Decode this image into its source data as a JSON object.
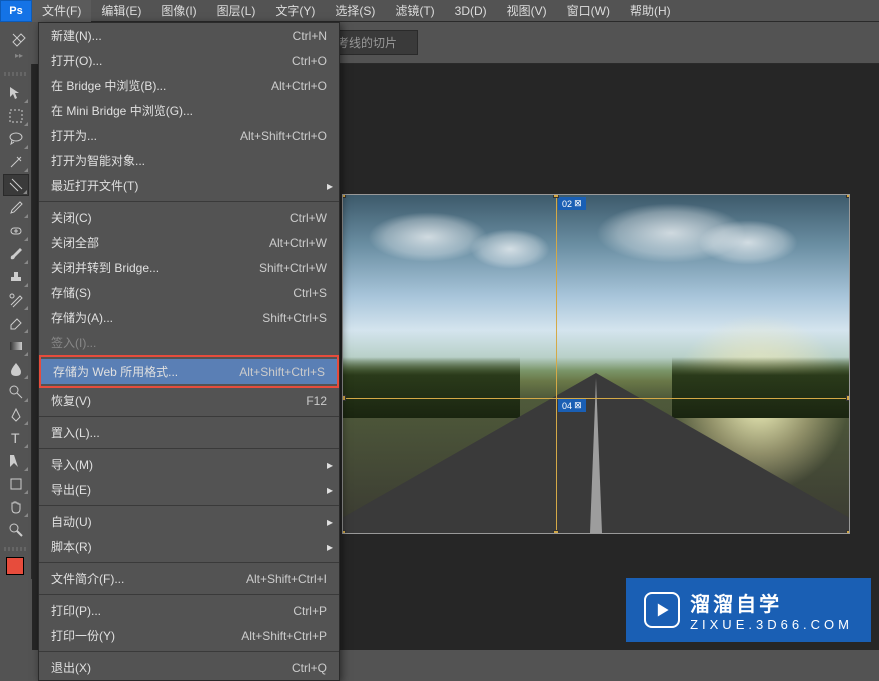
{
  "app": {
    "logo": "Ps"
  },
  "menubar": [
    {
      "label": "文件(F)",
      "active": true
    },
    {
      "label": "编辑(E)"
    },
    {
      "label": "图像(I)"
    },
    {
      "label": "图层(L)"
    },
    {
      "label": "文字(Y)"
    },
    {
      "label": "选择(S)"
    },
    {
      "label": "滤镜(T)"
    },
    {
      "label": "3D(D)"
    },
    {
      "label": "视图(V)"
    },
    {
      "label": "窗口(W)"
    },
    {
      "label": "帮助(H)"
    }
  ],
  "options_bar": {
    "ref_slice": "基于参考线的切片"
  },
  "file_menu": {
    "groups": [
      [
        {
          "label": "新建(N)...",
          "shortcut": "Ctrl+N"
        },
        {
          "label": "打开(O)...",
          "shortcut": "Ctrl+O"
        },
        {
          "label": "在 Bridge 中浏览(B)...",
          "shortcut": "Alt+Ctrl+O"
        },
        {
          "label": "在 Mini Bridge 中浏览(G)..."
        },
        {
          "label": "打开为...",
          "shortcut": "Alt+Shift+Ctrl+O"
        },
        {
          "label": "打开为智能对象..."
        },
        {
          "label": "最近打开文件(T)",
          "submenu": true
        }
      ],
      [
        {
          "label": "关闭(C)",
          "shortcut": "Ctrl+W"
        },
        {
          "label": "关闭全部",
          "shortcut": "Alt+Ctrl+W"
        },
        {
          "label": "关闭并转到 Bridge...",
          "shortcut": "Shift+Ctrl+W"
        },
        {
          "label": "存储(S)",
          "shortcut": "Ctrl+S"
        },
        {
          "label": "存储为(A)...",
          "shortcut": "Shift+Ctrl+S"
        },
        {
          "label": "签入(I)...",
          "dim": true
        },
        {
          "label": "存储为 Web 所用格式...",
          "shortcut": "Alt+Shift+Ctrl+S",
          "highlighted": true,
          "boxed": true
        },
        {
          "label": "恢复(V)",
          "shortcut": "F12"
        }
      ],
      [
        {
          "label": "置入(L)..."
        }
      ],
      [
        {
          "label": "导入(M)",
          "submenu": true
        },
        {
          "label": "导出(E)",
          "submenu": true
        }
      ],
      [
        {
          "label": "自动(U)",
          "submenu": true
        },
        {
          "label": "脚本(R)",
          "submenu": true
        }
      ],
      [
        {
          "label": "文件简介(F)...",
          "shortcut": "Alt+Shift+Ctrl+I"
        }
      ],
      [
        {
          "label": "打印(P)...",
          "shortcut": "Ctrl+P"
        },
        {
          "label": "打印一份(Y)",
          "shortcut": "Alt+Shift+Ctrl+P"
        }
      ],
      [
        {
          "label": "退出(X)",
          "shortcut": "Ctrl+Q"
        }
      ]
    ]
  },
  "slices": {
    "badge1": "02",
    "badge2": "04"
  },
  "watermark": {
    "title": "溜溜自学",
    "url": "ZIXUE.3D66.COM"
  },
  "colors": {
    "foreground": "#e74c3c"
  }
}
